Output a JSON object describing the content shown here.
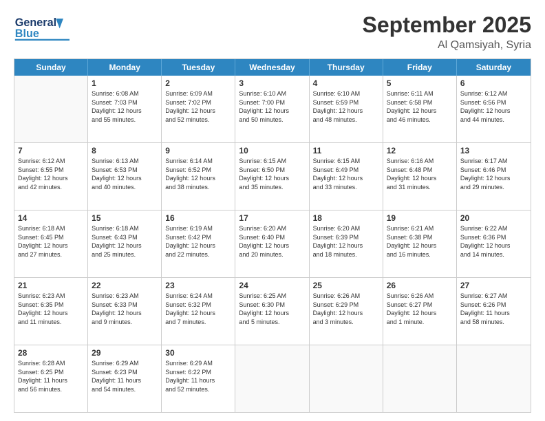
{
  "header": {
    "logo_line1": "General",
    "logo_line2": "Blue",
    "main_title": "September 2025",
    "subtitle": "Al Qamsiyah, Syria"
  },
  "calendar": {
    "days_of_week": [
      "Sunday",
      "Monday",
      "Tuesday",
      "Wednesday",
      "Thursday",
      "Friday",
      "Saturday"
    ],
    "weeks": [
      [
        {
          "day": "",
          "info": ""
        },
        {
          "day": "1",
          "info": "Sunrise: 6:08 AM\nSunset: 7:03 PM\nDaylight: 12 hours\nand 55 minutes."
        },
        {
          "day": "2",
          "info": "Sunrise: 6:09 AM\nSunset: 7:02 PM\nDaylight: 12 hours\nand 52 minutes."
        },
        {
          "day": "3",
          "info": "Sunrise: 6:10 AM\nSunset: 7:00 PM\nDaylight: 12 hours\nand 50 minutes."
        },
        {
          "day": "4",
          "info": "Sunrise: 6:10 AM\nSunset: 6:59 PM\nDaylight: 12 hours\nand 48 minutes."
        },
        {
          "day": "5",
          "info": "Sunrise: 6:11 AM\nSunset: 6:58 PM\nDaylight: 12 hours\nand 46 minutes."
        },
        {
          "day": "6",
          "info": "Sunrise: 6:12 AM\nSunset: 6:56 PM\nDaylight: 12 hours\nand 44 minutes."
        }
      ],
      [
        {
          "day": "7",
          "info": "Sunrise: 6:12 AM\nSunset: 6:55 PM\nDaylight: 12 hours\nand 42 minutes."
        },
        {
          "day": "8",
          "info": "Sunrise: 6:13 AM\nSunset: 6:53 PM\nDaylight: 12 hours\nand 40 minutes."
        },
        {
          "day": "9",
          "info": "Sunrise: 6:14 AM\nSunset: 6:52 PM\nDaylight: 12 hours\nand 38 minutes."
        },
        {
          "day": "10",
          "info": "Sunrise: 6:15 AM\nSunset: 6:50 PM\nDaylight: 12 hours\nand 35 minutes."
        },
        {
          "day": "11",
          "info": "Sunrise: 6:15 AM\nSunset: 6:49 PM\nDaylight: 12 hours\nand 33 minutes."
        },
        {
          "day": "12",
          "info": "Sunrise: 6:16 AM\nSunset: 6:48 PM\nDaylight: 12 hours\nand 31 minutes."
        },
        {
          "day": "13",
          "info": "Sunrise: 6:17 AM\nSunset: 6:46 PM\nDaylight: 12 hours\nand 29 minutes."
        }
      ],
      [
        {
          "day": "14",
          "info": "Sunrise: 6:18 AM\nSunset: 6:45 PM\nDaylight: 12 hours\nand 27 minutes."
        },
        {
          "day": "15",
          "info": "Sunrise: 6:18 AM\nSunset: 6:43 PM\nDaylight: 12 hours\nand 25 minutes."
        },
        {
          "day": "16",
          "info": "Sunrise: 6:19 AM\nSunset: 6:42 PM\nDaylight: 12 hours\nand 22 minutes."
        },
        {
          "day": "17",
          "info": "Sunrise: 6:20 AM\nSunset: 6:40 PM\nDaylight: 12 hours\nand 20 minutes."
        },
        {
          "day": "18",
          "info": "Sunrise: 6:20 AM\nSunset: 6:39 PM\nDaylight: 12 hours\nand 18 minutes."
        },
        {
          "day": "19",
          "info": "Sunrise: 6:21 AM\nSunset: 6:38 PM\nDaylight: 12 hours\nand 16 minutes."
        },
        {
          "day": "20",
          "info": "Sunrise: 6:22 AM\nSunset: 6:36 PM\nDaylight: 12 hours\nand 14 minutes."
        }
      ],
      [
        {
          "day": "21",
          "info": "Sunrise: 6:23 AM\nSunset: 6:35 PM\nDaylight: 12 hours\nand 11 minutes."
        },
        {
          "day": "22",
          "info": "Sunrise: 6:23 AM\nSunset: 6:33 PM\nDaylight: 12 hours\nand 9 minutes."
        },
        {
          "day": "23",
          "info": "Sunrise: 6:24 AM\nSunset: 6:32 PM\nDaylight: 12 hours\nand 7 minutes."
        },
        {
          "day": "24",
          "info": "Sunrise: 6:25 AM\nSunset: 6:30 PM\nDaylight: 12 hours\nand 5 minutes."
        },
        {
          "day": "25",
          "info": "Sunrise: 6:26 AM\nSunset: 6:29 PM\nDaylight: 12 hours\nand 3 minutes."
        },
        {
          "day": "26",
          "info": "Sunrise: 6:26 AM\nSunset: 6:27 PM\nDaylight: 12 hours\nand 1 minute."
        },
        {
          "day": "27",
          "info": "Sunrise: 6:27 AM\nSunset: 6:26 PM\nDaylight: 11 hours\nand 58 minutes."
        }
      ],
      [
        {
          "day": "28",
          "info": "Sunrise: 6:28 AM\nSunset: 6:25 PM\nDaylight: 11 hours\nand 56 minutes."
        },
        {
          "day": "29",
          "info": "Sunrise: 6:29 AM\nSunset: 6:23 PM\nDaylight: 11 hours\nand 54 minutes."
        },
        {
          "day": "30",
          "info": "Sunrise: 6:29 AM\nSunset: 6:22 PM\nDaylight: 11 hours\nand 52 minutes."
        },
        {
          "day": "",
          "info": ""
        },
        {
          "day": "",
          "info": ""
        },
        {
          "day": "",
          "info": ""
        },
        {
          "day": "",
          "info": ""
        }
      ]
    ]
  }
}
